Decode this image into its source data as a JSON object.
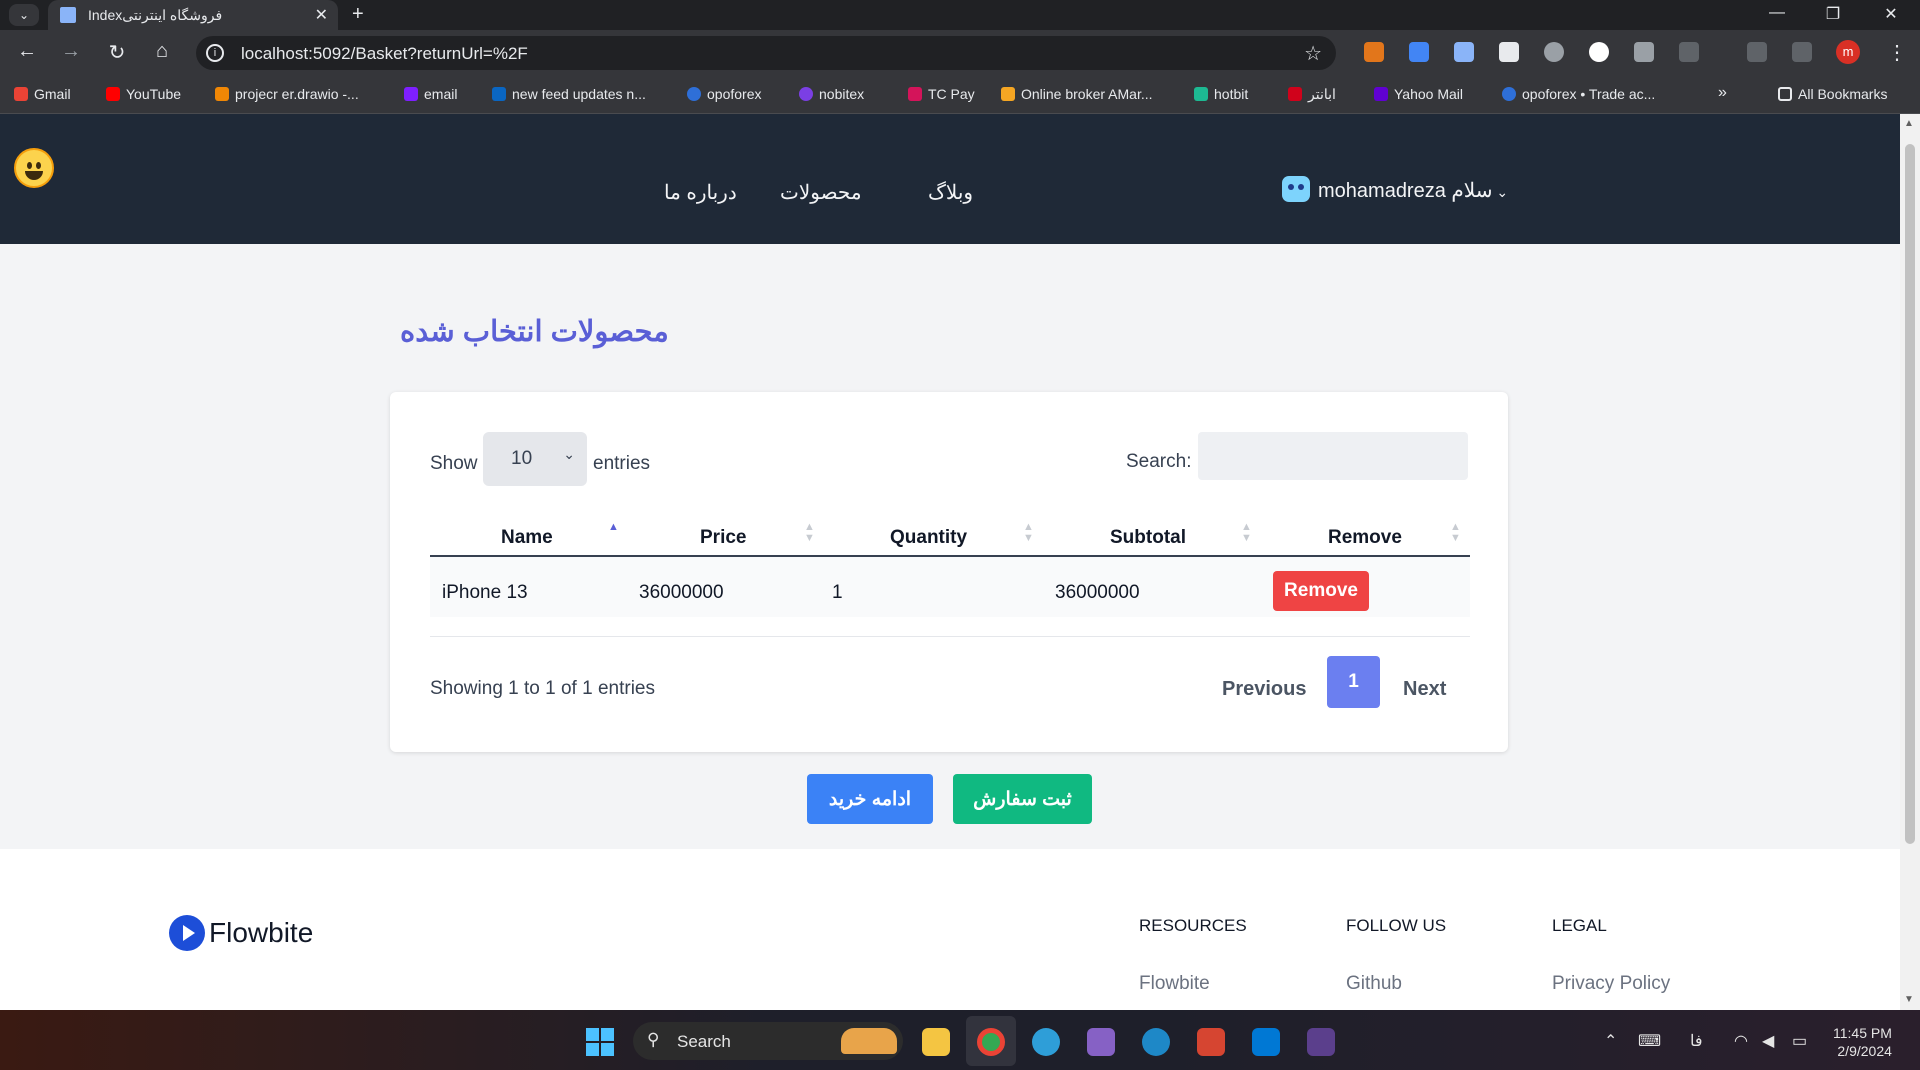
{
  "browser": {
    "tab_title": "Indexفروشگاه اینترنتی",
    "url": "localhost:5092/Basket?returnUrl=%2F",
    "profile_initial": "m",
    "bookmarks": [
      {
        "label": "Gmail",
        "color": "#ea4335"
      },
      {
        "label": "YouTube",
        "color": "#ff0000"
      },
      {
        "label": "projecr er.drawio -...",
        "color": "#f08705"
      },
      {
        "label": "email",
        "color": "#7e1fff"
      },
      {
        "label": "new feed updates n...",
        "color": "#0a66c2"
      },
      {
        "label": "opoforex",
        "color": "#2e6fd8"
      },
      {
        "label": "nobitex",
        "color": "#7b3fe4"
      },
      {
        "label": "TC Pay",
        "color": "#d4145a"
      },
      {
        "label": "Online broker AMar...",
        "color": "#f5a623"
      },
      {
        "label": "hotbit",
        "color": "#1db992"
      },
      {
        "label": "ابانتر",
        "color": "#d0021b"
      },
      {
        "label": "Yahoo Mail",
        "color": "#6001d2"
      },
      {
        "label": "opoforex • Trade ac...",
        "color": "#2e6fd8"
      }
    ],
    "all_bookmarks": "All Bookmarks"
  },
  "site": {
    "nav": {
      "about": "درباره ما",
      "products": "محصولات",
      "blog": "وبلاگ",
      "user_greeting": "mohamadreza سلام"
    },
    "section_title": "محصولات انتخاب شده",
    "table": {
      "show_label": "Show",
      "entries_value": "10",
      "entries_label": "entries",
      "search_label": "Search:",
      "search_value": "",
      "columns": [
        "Name",
        "Price",
        "Quantity",
        "Subtotal",
        "Remove"
      ],
      "rows": [
        {
          "name": "iPhone 13",
          "price": "36000000",
          "quantity": "1",
          "subtotal": "36000000",
          "remove": "Remove"
        }
      ],
      "info": "Showing 1 to 1 of 1 entries",
      "prev": "Previous",
      "page": "1",
      "next": "Next"
    },
    "buttons": {
      "continue_shopping": "ادامه خرید",
      "place_order": "ثبت سفارش"
    },
    "footer": {
      "brand": "Flowbite",
      "col1_head": "RESOURCES",
      "col1_link": "Flowbite",
      "col2_head": "FOLLOW US",
      "col2_link": "Github",
      "col3_head": "LEGAL",
      "col3_link": "Privacy Policy"
    }
  },
  "taskbar": {
    "search": "Search",
    "lang": "فا",
    "time": "11:45 PM",
    "date": "2/9/2024"
  },
  "colors": {
    "accent": "#5a5fd6",
    "danger": "#ef4444",
    "primary": "#3b82f6",
    "success": "#10b981",
    "navbar": "#1f2937"
  }
}
